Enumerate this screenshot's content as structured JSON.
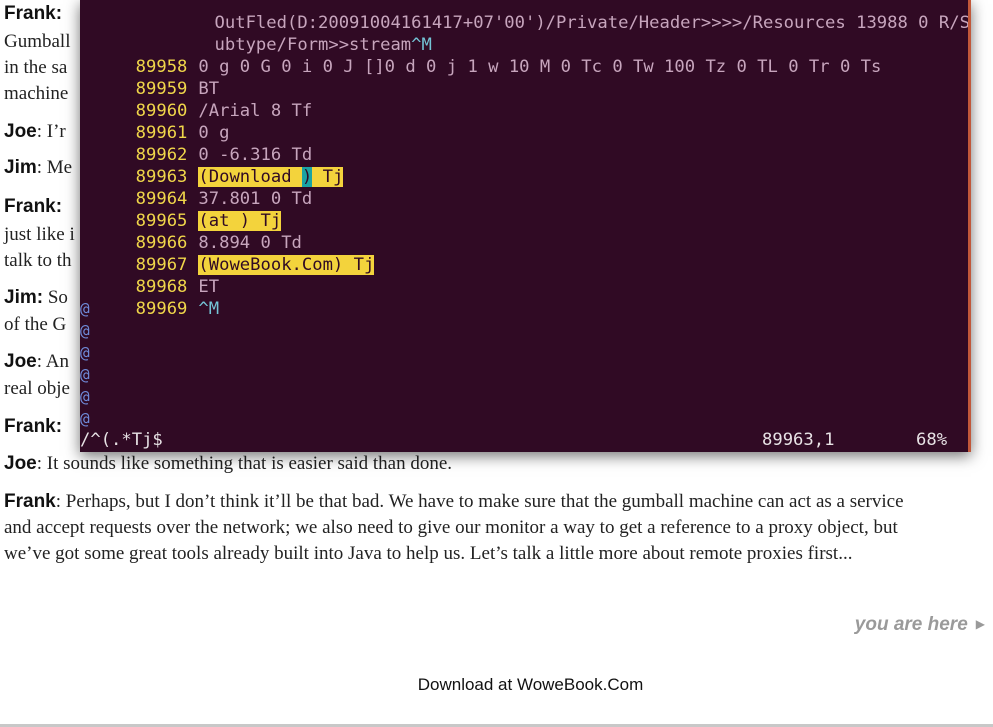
{
  "book": {
    "frag_frank_1": "Frank:",
    "frag_gumball": "Gumball",
    "frag_in_the_sa": "in the sa",
    "frag_machine": "machine",
    "frag_joe_1_speaker": "Joe",
    "frag_joe_1_text": ": I’r",
    "frag_jim_1_speaker": "Jim",
    "frag_jim_1_text": ": Me",
    "frag_frank_2": "Frank:",
    "frag_just_like": "just like i",
    "frag_talk_to": "talk to th",
    "frag_jim_2_speaker": "Jim:",
    "frag_jim_2_text": " So",
    "frag_of_the": "of the G",
    "frag_joe_2_speaker": "Joe",
    "frag_joe_2_text": ": An",
    "frag_real_obj": "real obje",
    "frag_frank_3": "Frank:",
    "joe_line_speaker": "Joe",
    "joe_line_text": ":  It sounds like something that is easier said than done.",
    "frank_final_speaker": "Frank",
    "frank_final_text": ":  Perhaps, but I don’t think it’ll be that bad.  We have to make sure that the gumball machine can act as a service and accept requests over the network; we also need to give our monitor a way to get a reference to a proxy object, but we’ve got some great tools already built into Java to help us. Let’s talk a little more about remote proxies first...",
    "you_are_here": "you are here",
    "footer": "Download at WoweBook.Com"
  },
  "terminal": {
    "top_line_1": "         OutFled(D:20091004161417+07'00')/Private/Header>>>>/Resources 13988 0 R/S",
    "top_line_2": "         ubtype/Form>>stream",
    "top_line_2_ctrl": "^M",
    "lines": [
      {
        "num": "89958",
        "text": "0 g 0 G 0 i 0 J []0 d 0 j 1 w 10 M 0 Tc 0 Tw 100 Tz 0 TL 0 Tr 0 Ts"
      },
      {
        "num": "89959",
        "text": "BT"
      },
      {
        "num": "89960",
        "text": "/Arial 8 Tf"
      },
      {
        "num": "89961",
        "text": "0 g"
      },
      {
        "num": "89962",
        "text": "0 -6.316 Td"
      },
      {
        "num": "89963",
        "text_a": "(Download ",
        "text_cursor": ")",
        "text_b": " Tj"
      },
      {
        "num": "89964",
        "text": "37.801 0 Td"
      },
      {
        "num": "89965",
        "text": "(at ) Tj"
      },
      {
        "num": "89966",
        "text": "8.894 0 Td"
      },
      {
        "num": "89967",
        "text": "(WoweBook.Com) Tj"
      },
      {
        "num": "89968",
        "text": "ET"
      },
      {
        "num": "89969",
        "text": "^M"
      }
    ],
    "tilde": "@",
    "status_search": "/^(.*Tj$",
    "status_position": "89963,1",
    "status_percent": "68%"
  }
}
